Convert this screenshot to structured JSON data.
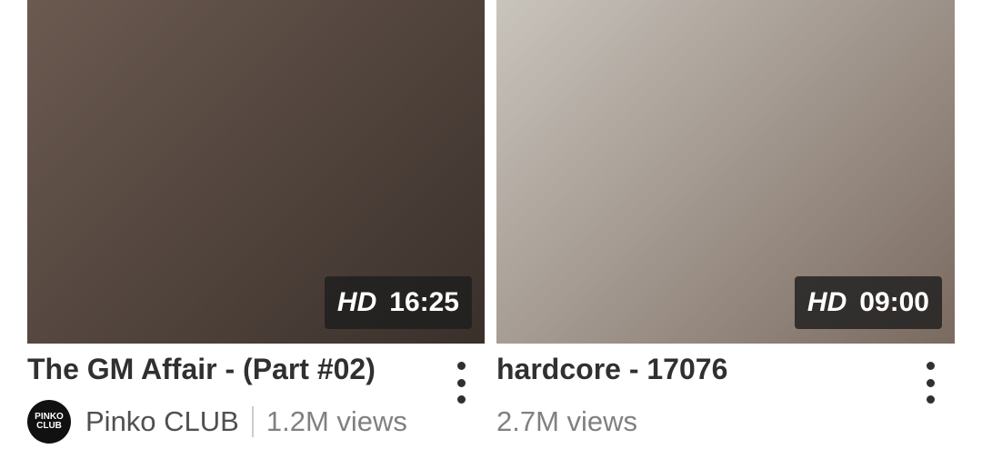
{
  "videos": [
    {
      "title": "The GM Affair - (Part #02)",
      "channel": "Pinko CLUB",
      "views": "1.2M views",
      "quality": "HD",
      "duration": "16:25",
      "avatar_text": "PINKO CLUB"
    },
    {
      "title": "hardcore - 17076",
      "views": "2.7M views",
      "quality": "HD",
      "duration": "09:00"
    }
  ]
}
